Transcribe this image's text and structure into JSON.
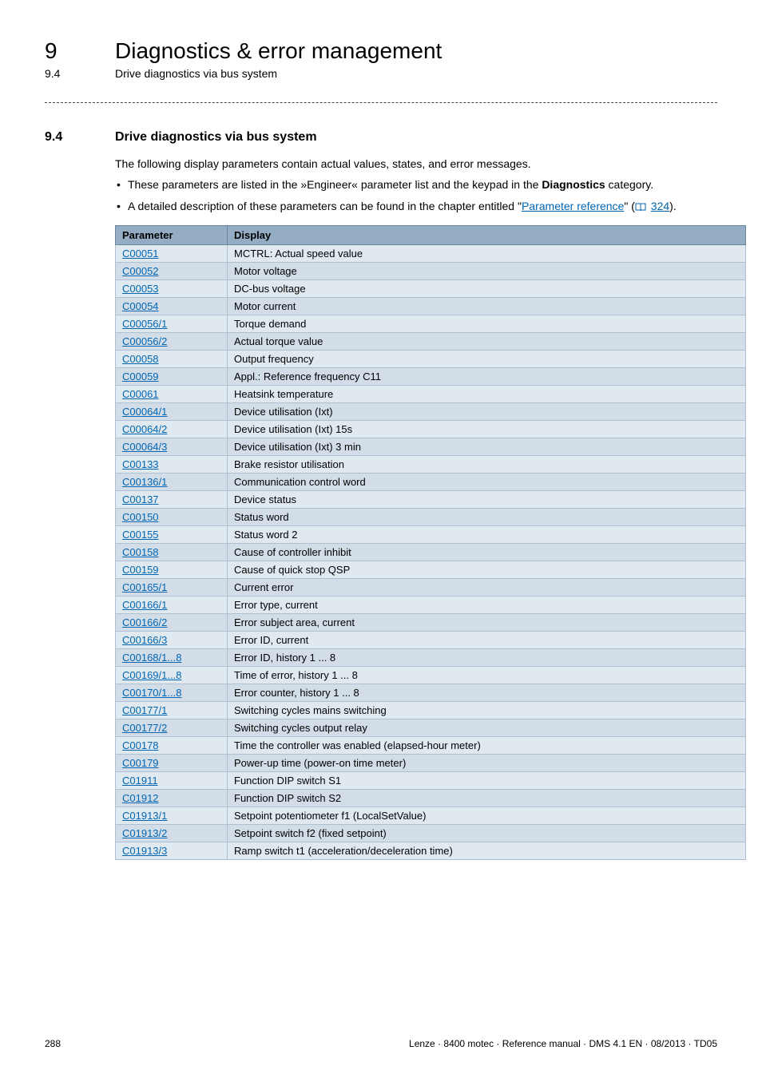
{
  "header": {
    "chapter_num": "9",
    "chapter_title": "Diagnostics & error management",
    "sub_num": "9.4",
    "sub_title": "Drive diagnostics via bus system"
  },
  "section": {
    "num": "9.4",
    "title": "Drive diagnostics via bus system",
    "intro": "The following display parameters contain actual values, states, and error messages.",
    "bullet1_a": "These parameters are listed in the »Engineer« parameter list and the keypad in the ",
    "bullet1_b": "Diagnostics",
    "bullet1_c": " category.",
    "bullet2_a": "A detailed description of these parameters can be found in the chapter entitled \"",
    "bullet2_link": "Parameter reference",
    "bullet2_b": "\" (",
    "bullet2_page": "324",
    "bullet2_c": ")."
  },
  "table": {
    "head_param": "Parameter",
    "head_display": "Display",
    "rows": [
      {
        "p": "C00051",
        "d": "MCTRL: Actual speed value"
      },
      {
        "p": "C00052",
        "d": "Motor voltage"
      },
      {
        "p": "C00053",
        "d": "DC-bus voltage"
      },
      {
        "p": "C00054",
        "d": "Motor current"
      },
      {
        "p": "C00056/1",
        "d": "Torque demand"
      },
      {
        "p": "C00056/2",
        "d": "Actual torque value"
      },
      {
        "p": "C00058",
        "d": "Output frequency"
      },
      {
        "p": "C00059",
        "d": "Appl.: Reference frequency C11"
      },
      {
        "p": "C00061",
        "d": "Heatsink temperature"
      },
      {
        "p": "C00064/1",
        "d": "Device utilisation (Ixt)"
      },
      {
        "p": "C00064/2",
        "d": "Device utilisation (Ixt) 15s"
      },
      {
        "p": "C00064/3",
        "d": "Device utilisation (Ixt) 3 min"
      },
      {
        "p": "C00133",
        "d": "Brake resistor utilisation"
      },
      {
        "p": "C00136/1",
        "d": "Communication control word"
      },
      {
        "p": "C00137",
        "d": "Device status"
      },
      {
        "p": "C00150",
        "d": "Status word"
      },
      {
        "p": "C00155",
        "d": "Status word 2"
      },
      {
        "p": "C00158",
        "d": "Cause of controller inhibit"
      },
      {
        "p": "C00159",
        "d": "Cause of quick stop QSP"
      },
      {
        "p": "C00165/1",
        "d": "Current error"
      },
      {
        "p": "C00166/1",
        "d": "Error type, current"
      },
      {
        "p": "C00166/2",
        "d": "Error subject area, current"
      },
      {
        "p": "C00166/3",
        "d": "Error ID, current"
      },
      {
        "p": "C00168/1...8",
        "d": "Error ID, history 1 ... 8"
      },
      {
        "p": "C00169/1...8",
        "d": "Time of error, history 1 ... 8"
      },
      {
        "p": "C00170/1...8",
        "d": "Error counter, history 1 ... 8"
      },
      {
        "p": "C00177/1",
        "d": "Switching cycles mains switching"
      },
      {
        "p": "C00177/2",
        "d": "Switching cycles output relay"
      },
      {
        "p": "C00178",
        "d": "Time the controller was enabled (elapsed-hour meter)"
      },
      {
        "p": "C00179",
        "d": "Power-up time (power-on time meter)"
      },
      {
        "p": "C01911",
        "d": "Function DIP switch S1"
      },
      {
        "p": "C01912",
        "d": "Function DIP switch S2"
      },
      {
        "p": "C01913/1",
        "d": "Setpoint potentiometer f1 (LocalSetValue)"
      },
      {
        "p": "C01913/2",
        "d": "Setpoint switch f2 (fixed setpoint)"
      },
      {
        "p": "C01913/3",
        "d": "Ramp switch t1 (acceleration/deceleration time)"
      }
    ]
  },
  "footer": {
    "page": "288",
    "meta": "Lenze · 8400 motec · Reference manual · DMS 4.1 EN · 08/2013 · TD05"
  }
}
